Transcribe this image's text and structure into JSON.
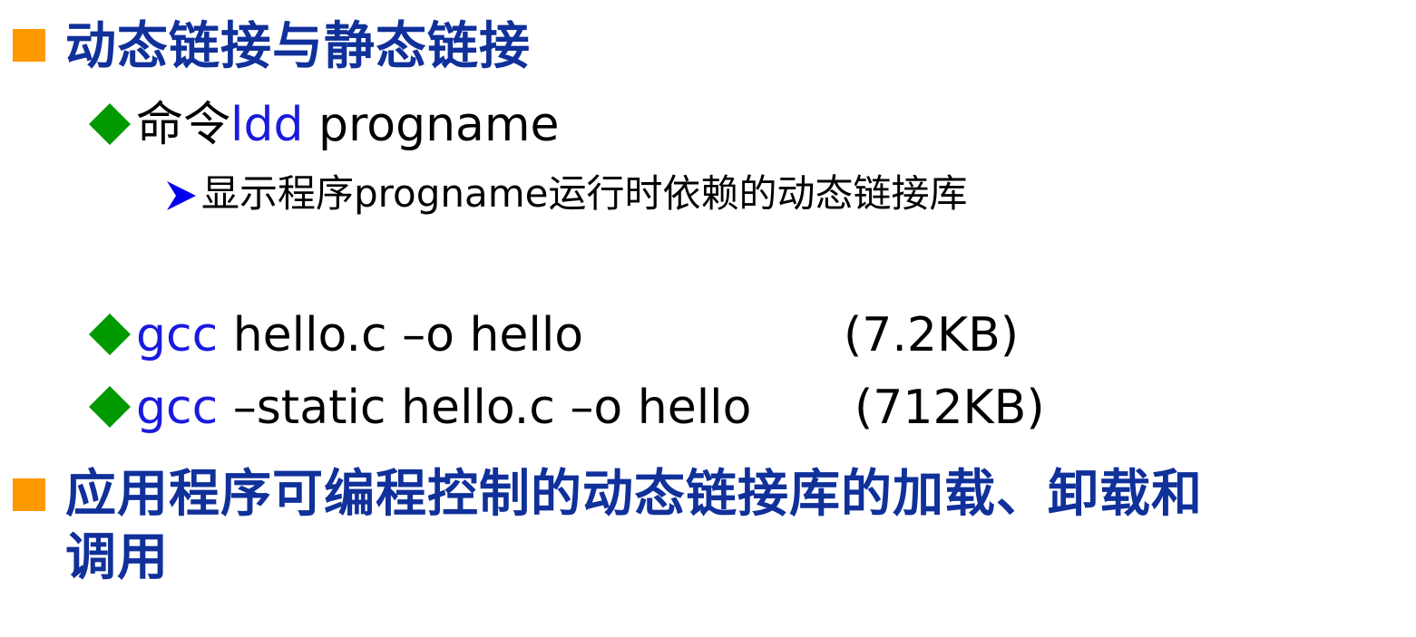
{
  "slide": {
    "bullets": [
      {
        "level": 1,
        "text": "动态链接与静态链接"
      },
      {
        "level": 2,
        "prefix": "命令",
        "command": "ldd",
        "rest": " progname"
      },
      {
        "level": 3,
        "text": "显示程序progname运行时依赖的动态链接库"
      },
      {
        "level": 2,
        "command": "gcc",
        "rest": " hello.c –o hello",
        "size": "(7.2KB)"
      },
      {
        "level": 2,
        "command": "gcc",
        "rest": " –static hello.c –o hello",
        "size": "(712KB)"
      },
      {
        "level": 1,
        "line1": "应用程序可编程控制的动态链接库的加载、卸载和",
        "line2": "调用"
      }
    ]
  },
  "colors": {
    "level1_bullet": "#ff9900",
    "level1_text": "#10309a",
    "level2_bullet": "#009900",
    "level3_bullet": "#0000ee",
    "command": "#1a1adf",
    "body_text": "#000000"
  },
  "icons": {
    "level1": "orange-square-icon",
    "level2": "green-diamond-icon",
    "level3": "blue-arrowhead-icon"
  }
}
